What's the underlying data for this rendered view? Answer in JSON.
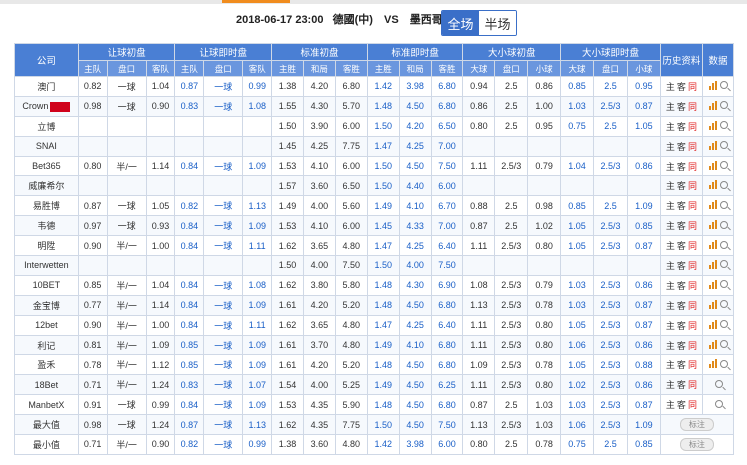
{
  "header": {
    "datetime": "2018-06-17 23:00",
    "home_team": "德國(中)",
    "vs": "VS",
    "away_team": "墨西哥",
    "tabs": [
      {
        "label": "全场",
        "active": true
      },
      {
        "label": "半场",
        "active": false
      }
    ]
  },
  "colors": {
    "header_blue": "#4a7fd4",
    "highlight_blue": "#1a5fc7",
    "red": "#e02020",
    "accent_orange": "#f08c1e"
  },
  "table": {
    "company_header": "公司",
    "groups": [
      "让球初盘",
      "让球即时盘",
      "标准初盘",
      "标准即时盘",
      "大小球初盘",
      "大小球即时盘"
    ],
    "history_header": "历史资料",
    "data_header": "数据",
    "subheaders": [
      "主队",
      "盘口",
      "客队",
      "主队",
      "盘口",
      "客队",
      "主胜",
      "和局",
      "客胜",
      "主胜",
      "和局",
      "客胜",
      "大球",
      "盘口",
      "小球",
      "大球",
      "盘口",
      "小球"
    ],
    "history_labels": {
      "home": "主",
      "away": "客",
      "same": "同"
    },
    "data_icons": [
      "bar-chart-icon",
      "magnifier-icon"
    ],
    "annotation_label": "标注",
    "rows": [
      {
        "company": "澳门",
        "badge": false,
        "cells": [
          "0.82",
          "一球",
          "1.04",
          "0.87",
          "一球",
          "0.99",
          "1.38",
          "4.20",
          "6.80",
          "1.42",
          "3.98",
          "6.80",
          "0.94",
          "2.5",
          "0.86",
          "0.85",
          "2.5",
          "0.95"
        ],
        "type": "odds",
        "chart": true
      },
      {
        "company": "Crown",
        "badge": true,
        "cells": [
          "0.98",
          "一球",
          "0.90",
          "0.83",
          "一球",
          "1.08",
          "1.55",
          "4.30",
          "5.70",
          "1.48",
          "4.50",
          "6.80",
          "0.86",
          "2.5",
          "1.00",
          "1.03",
          "2.5/3",
          "0.87"
        ],
        "type": "odds",
        "chart": true
      },
      {
        "company": "立博",
        "badge": false,
        "cells": [
          "",
          "",
          "",
          "",
          "",
          "",
          "1.50",
          "3.90",
          "6.00",
          "1.50",
          "4.20",
          "6.50",
          "0.80",
          "2.5",
          "0.95",
          "0.75",
          "2.5",
          "1.05"
        ],
        "type": "odds",
        "chart": true
      },
      {
        "company": "SNAI",
        "badge": false,
        "cells": [
          "",
          "",
          "",
          "",
          "",
          "",
          "1.45",
          "4.25",
          "7.75",
          "1.47",
          "4.25",
          "7.00",
          "",
          "",
          "",
          "",
          "",
          ""
        ],
        "type": "odds",
        "chart": true
      },
      {
        "company": "Bet365",
        "badge": false,
        "cells": [
          "0.80",
          "半/一",
          "1.14",
          "0.84",
          "一球",
          "1.09",
          "1.53",
          "4.10",
          "6.00",
          "1.50",
          "4.50",
          "7.50",
          "1.11",
          "2.5/3",
          "0.79",
          "1.04",
          "2.5/3",
          "0.86"
        ],
        "type": "odds",
        "chart": true
      },
      {
        "company": "威廉希尔",
        "badge": false,
        "cells": [
          "",
          "",
          "",
          "",
          "",
          "",
          "1.57",
          "3.60",
          "6.50",
          "1.50",
          "4.40",
          "6.00",
          "",
          "",
          "",
          "",
          "",
          ""
        ],
        "type": "odds",
        "chart": true
      },
      {
        "company": "易胜博",
        "badge": false,
        "cells": [
          "0.87",
          "一球",
          "1.05",
          "0.82",
          "一球",
          "1.13",
          "1.49",
          "4.00",
          "5.60",
          "1.49",
          "4.10",
          "6.70",
          "0.88",
          "2.5",
          "0.98",
          "0.85",
          "2.5",
          "1.09"
        ],
        "type": "odds",
        "chart": true
      },
      {
        "company": "韦德",
        "badge": false,
        "cells": [
          "0.97",
          "一球",
          "0.93",
          "0.84",
          "一球",
          "1.09",
          "1.53",
          "4.10",
          "6.00",
          "1.45",
          "4.33",
          "7.00",
          "0.87",
          "2.5",
          "1.02",
          "1.05",
          "2.5/3",
          "0.85"
        ],
        "type": "odds",
        "chart": true
      },
      {
        "company": "明陞",
        "badge": false,
        "cells": [
          "0.90",
          "半/一",
          "1.00",
          "0.84",
          "一球",
          "1.11",
          "1.62",
          "3.65",
          "4.80",
          "1.47",
          "4.25",
          "6.40",
          "1.11",
          "2.5/3",
          "0.80",
          "1.05",
          "2.5/3",
          "0.87"
        ],
        "type": "odds",
        "chart": true
      },
      {
        "company": "Interwetten",
        "badge": false,
        "cells": [
          "",
          "",
          "",
          "",
          "",
          "",
          "1.50",
          "4.00",
          "7.50",
          "1.50",
          "4.00",
          "7.50",
          "",
          "",
          "",
          "",
          "",
          ""
        ],
        "type": "odds",
        "chart": true
      },
      {
        "company": "10BET",
        "badge": false,
        "cells": [
          "0.85",
          "半/一",
          "1.04",
          "0.84",
          "一球",
          "1.08",
          "1.62",
          "3.80",
          "5.80",
          "1.48",
          "4.30",
          "6.90",
          "1.08",
          "2.5/3",
          "0.79",
          "1.03",
          "2.5/3",
          "0.86"
        ],
        "type": "odds",
        "chart": true
      },
      {
        "company": "金宝博",
        "badge": false,
        "cells": [
          "0.77",
          "半/一",
          "1.14",
          "0.84",
          "一球",
          "1.09",
          "1.61",
          "4.20",
          "5.20",
          "1.48",
          "4.50",
          "6.80",
          "1.13",
          "2.5/3",
          "0.78",
          "1.03",
          "2.5/3",
          "0.87"
        ],
        "type": "odds",
        "chart": true
      },
      {
        "company": "12bet",
        "badge": false,
        "cells": [
          "0.90",
          "半/一",
          "1.00",
          "0.84",
          "一球",
          "1.11",
          "1.62",
          "3.65",
          "4.80",
          "1.47",
          "4.25",
          "6.40",
          "1.11",
          "2.5/3",
          "0.80",
          "1.05",
          "2.5/3",
          "0.87"
        ],
        "type": "odds",
        "chart": true
      },
      {
        "company": "利记",
        "badge": false,
        "cells": [
          "0.81",
          "半/一",
          "1.09",
          "0.85",
          "一球",
          "1.09",
          "1.61",
          "3.70",
          "4.80",
          "1.49",
          "4.10",
          "6.80",
          "1.11",
          "2.5/3",
          "0.80",
          "1.06",
          "2.5/3",
          "0.86"
        ],
        "type": "odds",
        "chart": true
      },
      {
        "company": "盈禾",
        "badge": false,
        "cells": [
          "0.78",
          "半/一",
          "1.12",
          "0.85",
          "一球",
          "1.09",
          "1.61",
          "4.20",
          "5.20",
          "1.48",
          "4.50",
          "6.80",
          "1.09",
          "2.5/3",
          "0.78",
          "1.05",
          "2.5/3",
          "0.88"
        ],
        "type": "odds",
        "chart": true
      },
      {
        "company": "18Bet",
        "badge": false,
        "cells": [
          "0.71",
          "半/一",
          "1.24",
          "0.83",
          "一球",
          "1.07",
          "1.54",
          "4.00",
          "5.25",
          "1.49",
          "4.50",
          "6.25",
          "1.11",
          "2.5/3",
          "0.80",
          "1.02",
          "2.5/3",
          "0.86"
        ],
        "type": "odds",
        "chart": false
      },
      {
        "company": "ManbetX",
        "badge": false,
        "cells": [
          "0.91",
          "一球",
          "0.99",
          "0.84",
          "一球",
          "1.09",
          "1.53",
          "4.35",
          "5.90",
          "1.48",
          "4.50",
          "6.80",
          "0.87",
          "2.5",
          "1.03",
          "1.03",
          "2.5/3",
          "0.87"
        ],
        "type": "odds",
        "chart": false
      },
      {
        "company": "最大值",
        "badge": false,
        "cells": [
          "0.98",
          "一球",
          "1.24",
          "0.87",
          "一球",
          "1.13",
          "1.62",
          "4.35",
          "7.75",
          "1.50",
          "4.50",
          "7.50",
          "1.13",
          "2.5/3",
          "1.03",
          "1.06",
          "2.5/3",
          "1.09"
        ],
        "type": "summary"
      },
      {
        "company": "最小值",
        "badge": false,
        "cells": [
          "0.71",
          "半/一",
          "0.90",
          "0.82",
          "一球",
          "0.99",
          "1.38",
          "3.60",
          "4.80",
          "1.42",
          "3.98",
          "6.00",
          "0.80",
          "2.5",
          "0.78",
          "0.75",
          "2.5",
          "0.85"
        ],
        "type": "summary"
      }
    ]
  }
}
